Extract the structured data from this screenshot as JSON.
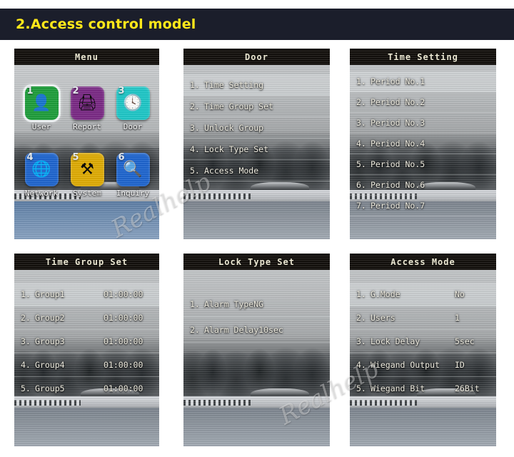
{
  "banner": {
    "title": "2.Access control model"
  },
  "watermarks": [
    {
      "text": "Realhelp"
    },
    {
      "text": "Realhelp"
    }
  ],
  "colors": {
    "banner_bg": "#1b1e2b",
    "banner_text": "#ffe81a",
    "titlebar_bg": "#13100c",
    "titlebar_text": "#f3efd8",
    "menu_text": "#f6f3e6",
    "icon_user": "#1f9f3c",
    "icon_report": "#7b2a86",
    "icon_door": "#1fc8c8",
    "icon_network": "#1f66d0",
    "icon_system": "#e0ad05",
    "icon_inquiry": "#1f66d0"
  },
  "screens": {
    "menu": {
      "title": "Menu",
      "icons": [
        {
          "number": "1",
          "label": "User",
          "icon": "user-card-icon",
          "glyph": "👤",
          "color": "#1f9f3c",
          "selected": true
        },
        {
          "number": "2",
          "label": "Report",
          "icon": "printer-icon",
          "glyph": "🖨",
          "color": "#7b2a86",
          "selected": false
        },
        {
          "number": "3",
          "label": "Door",
          "icon": "door-clock-icon",
          "glyph": "🕓",
          "color": "#1fc8c8",
          "selected": false
        },
        {
          "number": "4",
          "label": "Network",
          "icon": "globe-icon",
          "glyph": "🌐",
          "color": "#1f66d0",
          "selected": false
        },
        {
          "number": "5",
          "label": "System",
          "icon": "tools-icon",
          "glyph": "⚒",
          "color": "#e0ad05",
          "selected": false
        },
        {
          "number": "6",
          "label": "Inquiry",
          "icon": "magnifier-icon",
          "glyph": "🔍",
          "color": "#1f66d0",
          "selected": false
        }
      ]
    },
    "door": {
      "title": "Door",
      "items": [
        {
          "index": "1.",
          "label": "Time Setting",
          "selected": true
        },
        {
          "index": "2.",
          "label": "Time Group Set",
          "selected": false
        },
        {
          "index": "3.",
          "label": "Unlock Group",
          "selected": false
        },
        {
          "index": "4.",
          "label": "Lock Type Set",
          "selected": false
        },
        {
          "index": "5.",
          "label": "Access Mode",
          "selected": false
        }
      ]
    },
    "time_setting": {
      "title": "Time Setting",
      "items": [
        {
          "index": "1.",
          "label": "Period No.1",
          "selected": true
        },
        {
          "index": "2.",
          "label": "Period No.2",
          "selected": false
        },
        {
          "index": "3.",
          "label": "Period No.3",
          "selected": false
        },
        {
          "index": "4.",
          "label": "Period No.4",
          "selected": false
        },
        {
          "index": "5.",
          "label": "Period No.5",
          "selected": false
        },
        {
          "index": "6.",
          "label": "Period No.6",
          "selected": false
        },
        {
          "index": "7.",
          "label": "Period No.7",
          "selected": false
        }
      ]
    },
    "time_group_set": {
      "title": "Time Group Set",
      "items": [
        {
          "index": "1.",
          "label": "Group1",
          "value": "01:00:00",
          "selected": true
        },
        {
          "index": "2.",
          "label": "Group2",
          "value": "01:00:00",
          "selected": false
        },
        {
          "index": "3.",
          "label": "Group3",
          "value": "01:00:00",
          "selected": false
        },
        {
          "index": "4.",
          "label": "Group4",
          "value": "01:00:00",
          "selected": false
        },
        {
          "index": "5.",
          "label": "Group5",
          "value": "01:00:00",
          "selected": false
        }
      ]
    },
    "lock_type_set": {
      "title": "Lock Type Set",
      "items": [
        {
          "index": "1.",
          "label": "Alarm Type ",
          "value": "NG",
          "selected": false
        },
        {
          "index": "2.",
          "label": "Alarm Delay",
          "value": "10sec",
          "selected": false
        }
      ]
    },
    "access_mode": {
      "title": "Access Mode",
      "items": [
        {
          "index": "1.",
          "label": "G.Mode",
          "value": "No",
          "selected": true
        },
        {
          "index": "2.",
          "label": "Users",
          "value": "1",
          "selected": false
        },
        {
          "index": "3.",
          "label": "Lock Delay",
          "value": "5sec",
          "selected": false
        },
        {
          "index": "4.",
          "label": "Wiegand Output",
          "value": "ID",
          "selected": false
        },
        {
          "index": "5.",
          "label": "Wiegand Bit",
          "value": "26Bit",
          "selected": false
        }
      ]
    }
  }
}
